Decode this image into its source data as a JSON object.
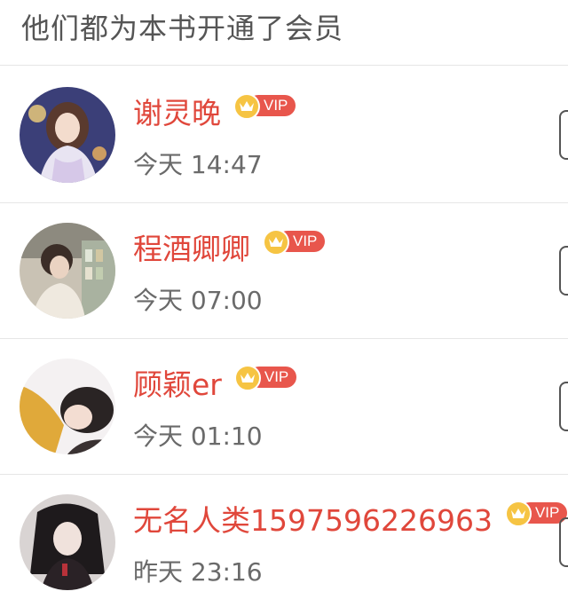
{
  "header": {
    "title": "他们都为本书开通了会员"
  },
  "vip_label": "VIP",
  "colors": {
    "name": "#e0473b",
    "vip_badge": "#e8564c",
    "crown": "#f6c443",
    "time": "#6a6a6a"
  },
  "members": [
    {
      "name": "谢灵晚",
      "time": "今天 14:47",
      "avatar_icon": "anime-girl-avatar"
    },
    {
      "name": "程酒卿卿",
      "time": "今天 07:00",
      "avatar_icon": "photo-girl-avatar"
    },
    {
      "name": "顾颖er",
      "time": "今天 01:10",
      "avatar_icon": "yellow-shirt-avatar"
    },
    {
      "name": "无名人类1597596226963",
      "time": "昨天 23:16",
      "avatar_icon": "dark-anime-avatar"
    }
  ]
}
